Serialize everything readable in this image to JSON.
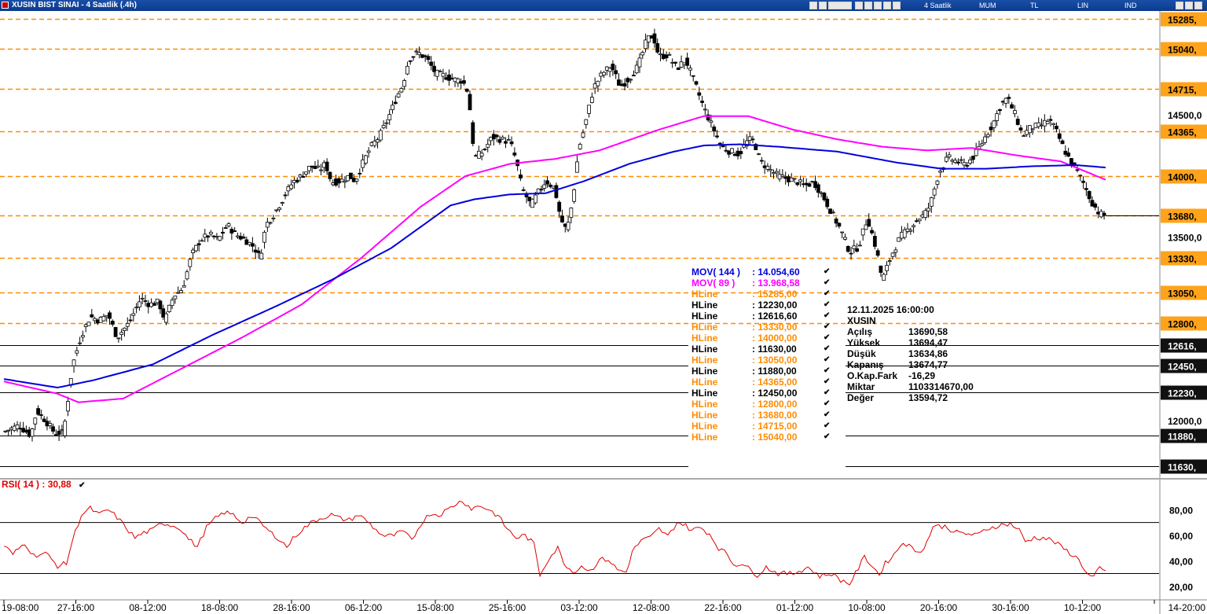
{
  "window": {
    "title": "XUSIN BIST SINAI - 4 Saatlik (.4h)"
  },
  "toolbar": {
    "period": "4 Saatlik",
    "chart_style": "MUM",
    "currency": "TL",
    "scale": "LIN",
    "mode": "IND"
  },
  "legend": {
    "mov144": {
      "name": "MOV( 144 )",
      "value": ": 14.054,60"
    },
    "mov89": {
      "name": "MOV( 89 )",
      "value": ": 13.968,58"
    },
    "hlines": [
      {
        "name": "HLine",
        "value": ": 15285,00",
        "color": "#ff8c00"
      },
      {
        "name": "HLine",
        "value": ": 12230,00",
        "color": "#000000"
      },
      {
        "name": "HLine",
        "value": ": 12616,60",
        "color": "#000000"
      },
      {
        "name": "HLine",
        "value": ": 13330,00",
        "color": "#ff8c00"
      },
      {
        "name": "HLine",
        "value": ": 14000,00",
        "color": "#ff8c00"
      },
      {
        "name": "HLine",
        "value": ": 11630,00",
        "color": "#000000"
      },
      {
        "name": "HLine",
        "value": ": 13050,00",
        "color": "#ff8c00"
      },
      {
        "name": "HLine",
        "value": ": 11880,00",
        "color": "#000000"
      },
      {
        "name": "HLine",
        "value": ": 14365,00",
        "color": "#ff8c00"
      },
      {
        "name": "HLine",
        "value": ": 12450,00",
        "color": "#000000"
      },
      {
        "name": "HLine",
        "value": ": 12800,00",
        "color": "#ff8c00"
      },
      {
        "name": "HLine",
        "value": ": 13680,00",
        "color": "#ff8c00"
      },
      {
        "name": "HLine",
        "value": ": 14715,00",
        "color": "#ff8c00"
      },
      {
        "name": "HLine",
        "value": ": 15040,00",
        "color": "#ff8c00"
      }
    ],
    "check_glyph": "✔"
  },
  "info": {
    "datetime": "12.11.2025  16:00:00",
    "symbol": "XUSIN",
    "rows": [
      {
        "k": "Açılış",
        "v": "13690,58"
      },
      {
        "k": "Yüksek",
        "v": "13694,47"
      },
      {
        "k": "Düşük",
        "v": "13634,86"
      },
      {
        "k": "Kapanış",
        "v": "13674,77"
      },
      {
        "k": "O.Kap.Fark",
        "v": "-16,29"
      },
      {
        "k": "Miktar",
        "v": "1103314670,00"
      },
      {
        "k": "Değer",
        "v": "13594,72"
      }
    ]
  },
  "rsi": {
    "name": "RSI( 14 )",
    "value": ": 30,88"
  },
  "colors": {
    "mov144": "#0000dd",
    "mov89": "#ff00ff",
    "orange": "#ff8c00",
    "rsi": "#e00000",
    "tag_bg": "#111111",
    "orange_tag": "#ffa31a"
  },
  "chart_data": {
    "type": "candlestick",
    "title": "XUSIN BIST SINAI - 4 Saatlik (.4h)",
    "price_axis": {
      "min": 11550,
      "max": 15350,
      "ticks": [
        12000,
        13500,
        14500
      ],
      "tick_labels": [
        "12000,0",
        "13500,0",
        "14500,0"
      ]
    },
    "x_tick_labels": [
      "19-08:00",
      "27-16:00",
      "08-12:00",
      "18-08:00",
      "28-16:00",
      "06-12:00",
      "15-08:00",
      "25-16:00",
      "03-12:00",
      "12-08:00",
      "22-16:00",
      "01-12:00",
      "10-08:00",
      "20-16:00",
      "30-16:00",
      "10-12:00",
      "14-20:00"
    ],
    "orange_levels": [
      15285,
      15040,
      14715,
      14365,
      14000,
      13680,
      13330,
      13050,
      12800
    ],
    "orange_level_labels": [
      "15285,",
      "15040,",
      "14715,",
      "14365,",
      "14000,",
      "13680,",
      "13330,",
      "13050,",
      "12800,"
    ],
    "black_levels": [
      12616.6,
      12450,
      12230,
      11880,
      11630
    ],
    "black_level_labels": [
      "12616,",
      "12450,",
      "12230,",
      "11880,",
      "11630,"
    ],
    "close_anchors": [
      [
        0,
        11910
      ],
      [
        10,
        11960
      ],
      [
        18,
        11880
      ],
      [
        22,
        12080
      ],
      [
        28,
        12000
      ],
      [
        34,
        11900
      ],
      [
        40,
        11900
      ],
      [
        46,
        12450
      ],
      [
        52,
        12700
      ],
      [
        58,
        12850
      ],
      [
        64,
        12820
      ],
      [
        70,
        12870
      ],
      [
        76,
        12680
      ],
      [
        84,
        12800
      ],
      [
        92,
        13000
      ],
      [
        98,
        12950
      ],
      [
        104,
        12970
      ],
      [
        108,
        12820
      ],
      [
        114,
        13020
      ],
      [
        120,
        13080
      ],
      [
        126,
        13350
      ],
      [
        132,
        13480
      ],
      [
        138,
        13520
      ],
      [
        144,
        13480
      ],
      [
        150,
        13600
      ],
      [
        156,
        13520
      ],
      [
        162,
        13480
      ],
      [
        168,
        13420
      ],
      [
        172,
        13330
      ],
      [
        176,
        13600
      ],
      [
        182,
        13700
      ],
      [
        188,
        13830
      ],
      [
        194,
        13950
      ],
      [
        200,
        14000
      ],
      [
        206,
        14080
      ],
      [
        212,
        14050
      ],
      [
        216,
        14100
      ],
      [
        220,
        13950
      ],
      [
        226,
        13960
      ],
      [
        232,
        14000
      ],
      [
        236,
        13960
      ],
      [
        240,
        14080
      ],
      [
        246,
        14230
      ],
      [
        252,
        14320
      ],
      [
        258,
        14470
      ],
      [
        264,
        14650
      ],
      [
        268,
        14750
      ],
      [
        272,
        14960
      ],
      [
        278,
        15010
      ],
      [
        284,
        14960
      ],
      [
        290,
        14840
      ],
      [
        296,
        14820
      ],
      [
        302,
        14790
      ],
      [
        308,
        14780
      ],
      [
        312,
        14680
      ],
      [
        316,
        14150
      ],
      [
        322,
        14200
      ],
      [
        328,
        14320
      ],
      [
        334,
        14300
      ],
      [
        340,
        14280
      ],
      [
        344,
        14130
      ],
      [
        348,
        13900
      ],
      [
        354,
        13760
      ],
      [
        358,
        13850
      ],
      [
        364,
        13960
      ],
      [
        370,
        13900
      ],
      [
        374,
        13650
      ],
      [
        378,
        13550
      ],
      [
        382,
        13800
      ],
      [
        386,
        14220
      ],
      [
        390,
        14400
      ],
      [
        396,
        14720
      ],
      [
        402,
        14840
      ],
      [
        408,
        14900
      ],
      [
        414,
        14730
      ],
      [
        420,
        14800
      ],
      [
        426,
        14900
      ],
      [
        432,
        15120
      ],
      [
        436,
        15150
      ],
      [
        440,
        14980
      ],
      [
        446,
        14990
      ],
      [
        452,
        14880
      ],
      [
        458,
        14950
      ],
      [
        464,
        14760
      ],
      [
        470,
        14560
      ],
      [
        476,
        14400
      ],
      [
        482,
        14240
      ],
      [
        488,
        14200
      ],
      [
        494,
        14180
      ],
      [
        500,
        14300
      ],
      [
        504,
        14280
      ],
      [
        508,
        14120
      ],
      [
        514,
        14060
      ],
      [
        520,
        14000
      ],
      [
        526,
        13980
      ],
      [
        532,
        13960
      ],
      [
        538,
        13920
      ],
      [
        544,
        13950
      ],
      [
        550,
        13840
      ],
      [
        556,
        13700
      ],
      [
        562,
        13560
      ],
      [
        568,
        13380
      ],
      [
        574,
        13420
      ],
      [
        580,
        13660
      ],
      [
        586,
        13400
      ],
      [
        590,
        13150
      ],
      [
        596,
        13350
      ],
      [
        602,
        13500
      ],
      [
        608,
        13570
      ],
      [
        614,
        13650
      ],
      [
        618,
        13680
      ],
      [
        622,
        13760
      ],
      [
        628,
        14030
      ],
      [
        634,
        14150
      ],
      [
        640,
        14120
      ],
      [
        646,
        14090
      ],
      [
        652,
        14170
      ],
      [
        656,
        14250
      ],
      [
        660,
        14340
      ],
      [
        664,
        14420
      ],
      [
        670,
        14590
      ],
      [
        674,
        14640
      ],
      [
        680,
        14480
      ],
      [
        684,
        14330
      ],
      [
        690,
        14400
      ],
      [
        696,
        14410
      ],
      [
        702,
        14460
      ],
      [
        706,
        14390
      ],
      [
        712,
        14220
      ],
      [
        716,
        14130
      ],
      [
        720,
        14060
      ],
      [
        726,
        13920
      ],
      [
        730,
        13800
      ],
      [
        736,
        13690
      ],
      [
        740,
        13675
      ]
    ],
    "mov144_anchors": [
      [
        0,
        12340
      ],
      [
        36,
        12270
      ],
      [
        60,
        12330
      ],
      [
        100,
        12460
      ],
      [
        140,
        12700
      ],
      [
        180,
        12920
      ],
      [
        220,
        13150
      ],
      [
        260,
        13410
      ],
      [
        300,
        13760
      ],
      [
        316,
        13810
      ],
      [
        340,
        13850
      ],
      [
        364,
        13860
      ],
      [
        390,
        13960
      ],
      [
        420,
        14100
      ],
      [
        450,
        14200
      ],
      [
        470,
        14250
      ],
      [
        494,
        14260
      ],
      [
        520,
        14240
      ],
      [
        560,
        14200
      ],
      [
        600,
        14110
      ],
      [
        630,
        14060
      ],
      [
        660,
        14060
      ],
      [
        690,
        14080
      ],
      [
        720,
        14090
      ],
      [
        740,
        14070
      ]
    ],
    "mov89_anchors": [
      [
        0,
        12320
      ],
      [
        36,
        12220
      ],
      [
        50,
        12150
      ],
      [
        80,
        12180
      ],
      [
        120,
        12430
      ],
      [
        160,
        12680
      ],
      [
        200,
        12950
      ],
      [
        240,
        13330
      ],
      [
        280,
        13750
      ],
      [
        310,
        14000
      ],
      [
        340,
        14100
      ],
      [
        370,
        14140
      ],
      [
        400,
        14210
      ],
      [
        440,
        14380
      ],
      [
        470,
        14490
      ],
      [
        500,
        14490
      ],
      [
        530,
        14380
      ],
      [
        560,
        14300
      ],
      [
        590,
        14240
      ],
      [
        620,
        14210
      ],
      [
        650,
        14230
      ],
      [
        680,
        14170
      ],
      [
        710,
        14120
      ],
      [
        740,
        13970
      ]
    ],
    "rsi_panel": {
      "ymin": 10,
      "ymax": 95,
      "ticks": [
        20,
        40,
        60,
        80
      ],
      "tick_labels": [
        "20,00",
        "40,00",
        "60,00",
        "80,00"
      ],
      "levels": [
        30,
        70
      ]
    },
    "rsi_anchors": [
      [
        0,
        52
      ],
      [
        6,
        45
      ],
      [
        14,
        54
      ],
      [
        20,
        44
      ],
      [
        28,
        46
      ],
      [
        36,
        36
      ],
      [
        42,
        38
      ],
      [
        46,
        56
      ],
      [
        52,
        76
      ],
      [
        58,
        81
      ],
      [
        64,
        76
      ],
      [
        70,
        80
      ],
      [
        76,
        74
      ],
      [
        82,
        66
      ],
      [
        88,
        58
      ],
      [
        94,
        62
      ],
      [
        100,
        64
      ],
      [
        106,
        70
      ],
      [
        112,
        68
      ],
      [
        118,
        66
      ],
      [
        124,
        57
      ],
      [
        130,
        51
      ],
      [
        136,
        66
      ],
      [
        142,
        73
      ],
      [
        148,
        78
      ],
      [
        154,
        76
      ],
      [
        160,
        70
      ],
      [
        166,
        75
      ],
      [
        172,
        70
      ],
      [
        178,
        63
      ],
      [
        184,
        58
      ],
      [
        190,
        51
      ],
      [
        196,
        60
      ],
      [
        202,
        66
      ],
      [
        208,
        71
      ],
      [
        214,
        74
      ],
      [
        220,
        76
      ],
      [
        226,
        73
      ],
      [
        232,
        72
      ],
      [
        238,
        76
      ],
      [
        244,
        71
      ],
      [
        250,
        64
      ],
      [
        256,
        59
      ],
      [
        262,
        60
      ],
      [
        268,
        63
      ],
      [
        274,
        56
      ],
      [
        280,
        69
      ],
      [
        286,
        77
      ],
      [
        292,
        76
      ],
      [
        298,
        80
      ],
      [
        304,
        85
      ],
      [
        308,
        87
      ],
      [
        314,
        81
      ],
      [
        320,
        83
      ],
      [
        326,
        80
      ],
      [
        332,
        75
      ],
      [
        338,
        65
      ],
      [
        344,
        58
      ],
      [
        350,
        60
      ],
      [
        356,
        53
      ],
      [
        360,
        29
      ],
      [
        366,
        42
      ],
      [
        372,
        50
      ],
      [
        376,
        39
      ],
      [
        382,
        31
      ],
      [
        388,
        36
      ],
      [
        394,
        32
      ],
      [
        400,
        41
      ],
      [
        406,
        41
      ],
      [
        412,
        33
      ],
      [
        418,
        31
      ],
      [
        422,
        47
      ],
      [
        428,
        56
      ],
      [
        434,
        58
      ],
      [
        440,
        65
      ],
      [
        446,
        59
      ],
      [
        452,
        70
      ],
      [
        456,
        69
      ],
      [
        462,
        64
      ],
      [
        468,
        66
      ],
      [
        474,
        61
      ],
      [
        480,
        50
      ],
      [
        486,
        45
      ],
      [
        490,
        37
      ],
      [
        496,
        38
      ],
      [
        502,
        32
      ],
      [
        506,
        29
      ],
      [
        512,
        35
      ],
      [
        520,
        30
      ],
      [
        530,
        30
      ],
      [
        540,
        35
      ],
      [
        548,
        28
      ],
      [
        556,
        30
      ],
      [
        562,
        25
      ],
      [
        568,
        22
      ],
      [
        572,
        30
      ],
      [
        578,
        43
      ],
      [
        584,
        35
      ],
      [
        588,
        29
      ],
      [
        592,
        38
      ],
      [
        598,
        45
      ],
      [
        604,
        55
      ],
      [
        612,
        48
      ],
      [
        618,
        49
      ],
      [
        624,
        67
      ],
      [
        632,
        67
      ],
      [
        640,
        62
      ],
      [
        648,
        61
      ],
      [
        654,
        60
      ],
      [
        660,
        65
      ],
      [
        666,
        67
      ],
      [
        670,
        68
      ],
      [
        676,
        69
      ],
      [
        682,
        64
      ],
      [
        686,
        55
      ],
      [
        692,
        58
      ],
      [
        698,
        58
      ],
      [
        704,
        56
      ],
      [
        710,
        51
      ],
      [
        716,
        46
      ],
      [
        722,
        41
      ],
      [
        728,
        29
      ],
      [
        732,
        27
      ],
      [
        736,
        34
      ],
      [
        740,
        31
      ]
    ]
  }
}
